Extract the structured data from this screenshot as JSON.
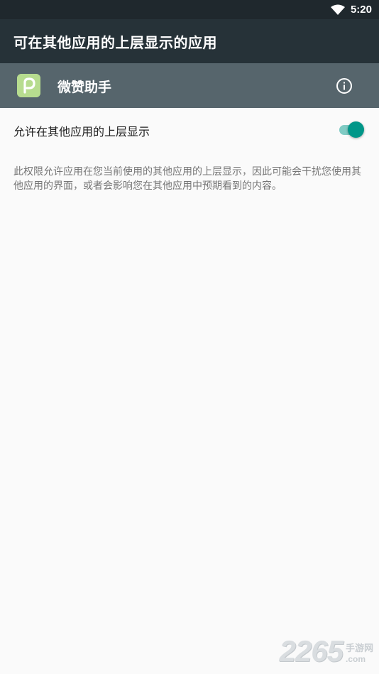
{
  "status_bar": {
    "time": "5:20",
    "wifi_icon": "wifi-icon"
  },
  "toolbar": {
    "title": "可在其他应用的上层显示的应用"
  },
  "app": {
    "name": "微赞助手",
    "icon": "app-icon",
    "icon_color": "#b7dc8f",
    "info_icon": "info-icon"
  },
  "permission": {
    "label": "允许在其他应用的上层显示",
    "enabled": true,
    "summary": "此权限允许应用在您当前使用的其他应用的上层显示，因此可能会干扰您使用其他应用的界面，或者会影响您在其他应用中预期看到的内容。"
  },
  "watermark": {
    "number": "2265",
    "site_cn": "手游网",
    "site_domain": ".com"
  },
  "colors": {
    "status_bar": "#1f282d",
    "toolbar": "#263238",
    "app_header": "#56656c",
    "accent": "#009688",
    "background": "#fafafa"
  }
}
